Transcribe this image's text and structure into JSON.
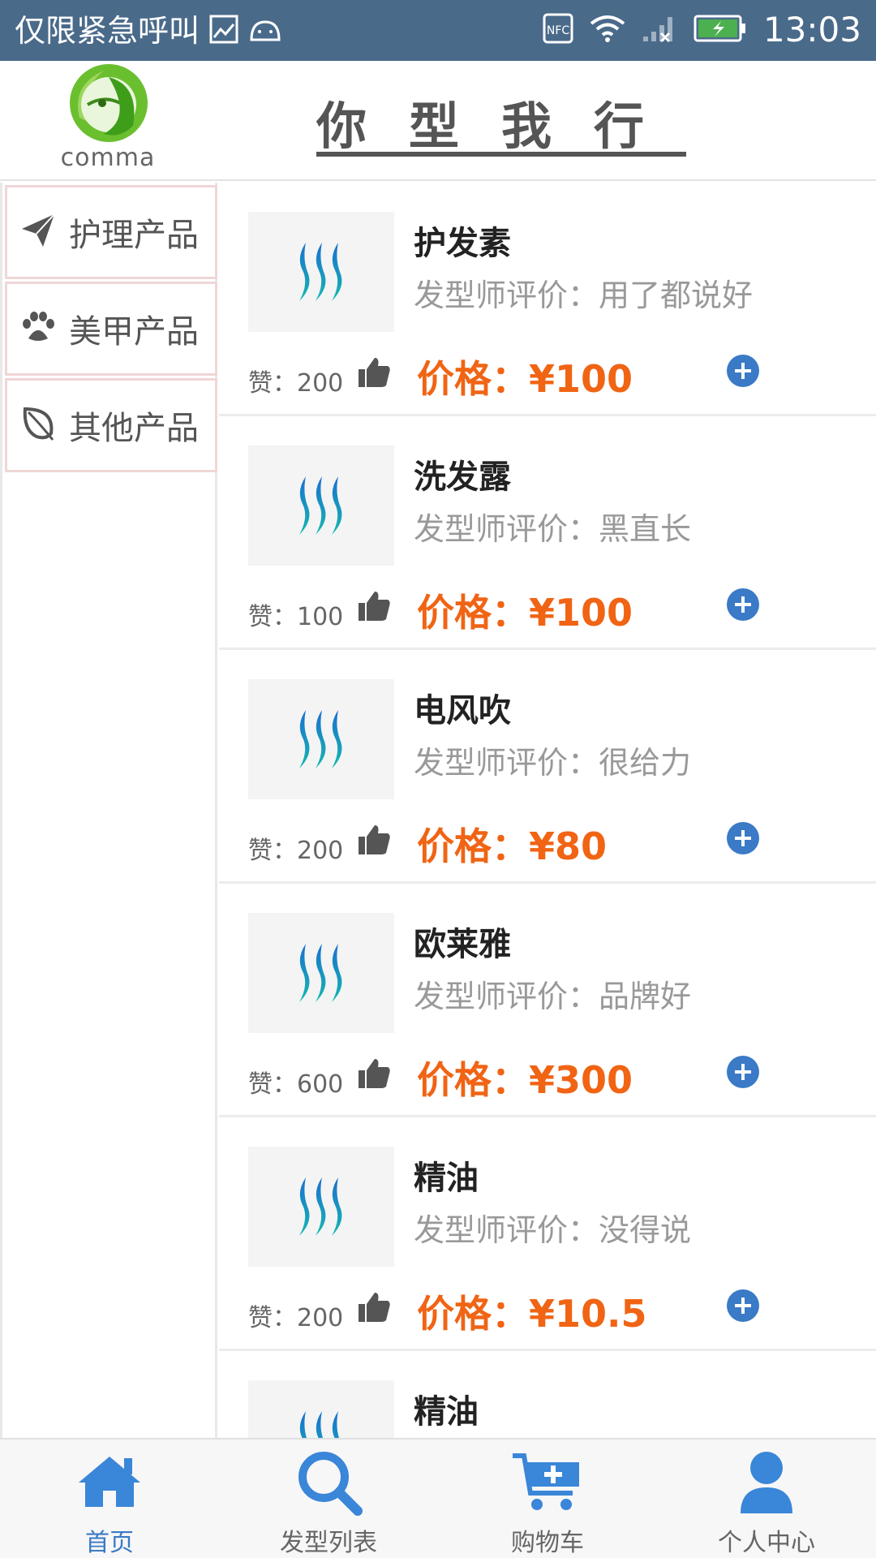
{
  "status_bar": {
    "carrier": "仅限紧急呼叫",
    "time": "13:03",
    "nfc": "NFC"
  },
  "header": {
    "logo_text": "comma",
    "title": "你型我行"
  },
  "sidebar": {
    "items": [
      {
        "label": "护理产品",
        "icon": "paper-plane-icon"
      },
      {
        "label": "美甲产品",
        "icon": "paw-icon"
      },
      {
        "label": "其他产品",
        "icon": "leaf-icon"
      }
    ]
  },
  "products": [
    {
      "name": "护发素",
      "review": "发型师评价：用了都说好",
      "likes": "赞：200",
      "price": "价格：¥100"
    },
    {
      "name": "洗发露",
      "review": "发型师评价：黑直长",
      "likes": "赞：100",
      "price": "价格：¥100"
    },
    {
      "name": "电风吹",
      "review": "发型师评价：很给力",
      "likes": "赞：200",
      "price": "价格：¥80"
    },
    {
      "name": "欧莱雅",
      "review": "发型师评价：品牌好",
      "likes": "赞：600",
      "price": "价格：¥300"
    },
    {
      "name": "精油",
      "review": "发型师评价：没得说",
      "likes": "赞：200",
      "price": "价格：¥10.5"
    },
    {
      "name": "精油"
    }
  ],
  "tabbar": {
    "items": [
      {
        "label": "首页",
        "icon": "home-icon"
      },
      {
        "label": "发型列表",
        "icon": "search-icon"
      },
      {
        "label": "购物车",
        "icon": "cart-icon"
      },
      {
        "label": "个人中心",
        "icon": "user-icon"
      }
    ]
  },
  "colors": {
    "accent": "#3a7ac6",
    "price": "#f06414",
    "status_bar": "#4a6a8a"
  }
}
